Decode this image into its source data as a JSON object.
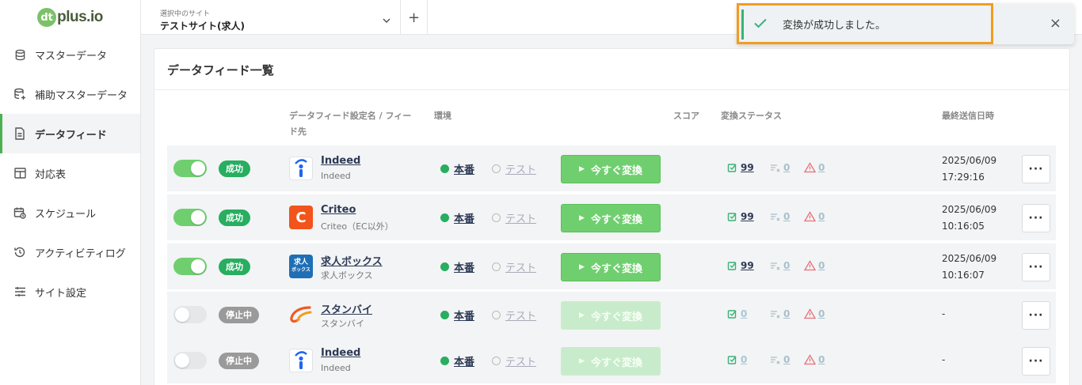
{
  "sidebar": {
    "logo_mark": "dt",
    "logo_text": "plus.io",
    "items": [
      {
        "label": "マスターデータ",
        "icon": "database-icon",
        "active": false
      },
      {
        "label": "補助マスターデータ",
        "icon": "database-plus-icon",
        "active": false
      },
      {
        "label": "データフィード",
        "icon": "document-icon",
        "active": true
      },
      {
        "label": "対応表",
        "icon": "table-icon",
        "active": false
      },
      {
        "label": "スケジュール",
        "icon": "calendar-icon",
        "active": false
      },
      {
        "label": "アクティビティログ",
        "icon": "history-icon",
        "active": false
      },
      {
        "label": "サイト設定",
        "icon": "sliders-icon",
        "active": false
      }
    ]
  },
  "topbar": {
    "site_label": "選択中のサイト",
    "site_value": "テストサイト(求人)",
    "add_label": "+"
  },
  "toast": {
    "message": "変換が成功しました。",
    "close": "×"
  },
  "card": {
    "title": "データフィード一覧",
    "headers": {
      "name_line1": "データフィード設定名 / フィー",
      "name_line2": "ド先",
      "env": "環境",
      "score": "スコア",
      "status": "変換ステータス",
      "last_sent": "最終送信日時"
    }
  },
  "common": {
    "prod": "本番",
    "test": "テスト",
    "convert": "今すぐ変換",
    "more": "···"
  },
  "rows": [
    {
      "enabled": true,
      "badge": "成功",
      "logo": "indeed",
      "name": "Indeed",
      "sub": "Indeed",
      "ok": "99",
      "skip": "0",
      "warn": "0",
      "date1": "2025/06/09",
      "date2": "17:29:16"
    },
    {
      "enabled": true,
      "badge": "成功",
      "logo": "criteo",
      "name": "Criteo",
      "sub": "Criteo（EC以外）",
      "ok": "99",
      "skip": "0",
      "warn": "0",
      "date1": "2025/06/09",
      "date2": "10:16:05"
    },
    {
      "enabled": true,
      "badge": "成功",
      "logo": "kyujin",
      "name": "求人ボックス",
      "sub": "求人ボックス",
      "ok": "99",
      "skip": "0",
      "warn": "0",
      "date1": "2025/06/09",
      "date2": "10:16:07"
    },
    {
      "enabled": false,
      "badge": "停止中",
      "logo": "stanby",
      "name": "スタンバイ",
      "sub": "スタンバイ",
      "ok": "0",
      "skip": "0",
      "warn": "0",
      "date1": "-",
      "date2": ""
    },
    {
      "enabled": false,
      "badge": "停止中",
      "logo": "indeed",
      "name": "Indeed",
      "sub": "Indeed",
      "ok": "0",
      "skip": "0",
      "warn": "0",
      "date1": "-",
      "date2": ""
    }
  ],
  "logo_text": {
    "criteo": "C",
    "kyujin_1": "求人",
    "kyujin_2": "ボックス"
  },
  "colors": {
    "accent_green": "#6fcf6f",
    "success_badge": "#27ae60",
    "toast_highlight": "#f29c1f"
  }
}
